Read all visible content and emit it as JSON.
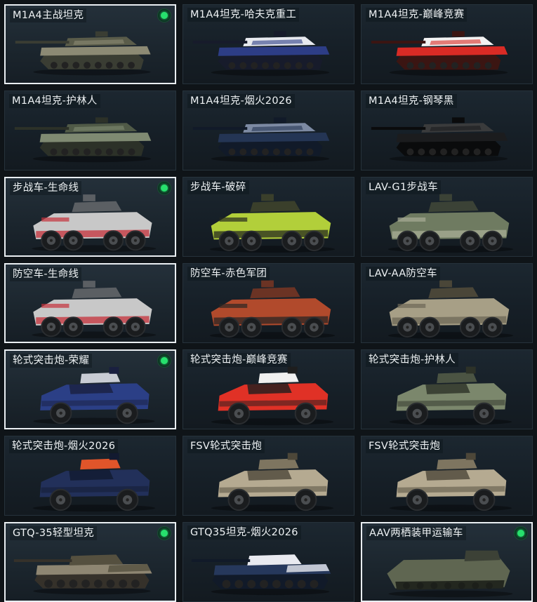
{
  "vehicles": [
    {
      "label": "M1A4主战坦克",
      "type": "tank",
      "colors": [
        "#8c8a74",
        "#5a5c4a",
        "#3a3d33"
      ],
      "selected": true,
      "badge": true
    },
    {
      "label": "M1A4坦克-哈夫克重工",
      "type": "tank",
      "colors": [
        "#2d3d86",
        "#e7e9ee",
        "#171b2b"
      ],
      "selected": false,
      "badge": false
    },
    {
      "label": "M1A4坦克-巅峰竞赛",
      "type": "tank",
      "colors": [
        "#d92b25",
        "#f2f2f2",
        "#3b1512"
      ],
      "selected": false,
      "badge": false
    },
    {
      "label": "M1A4坦克-护林人",
      "type": "tank",
      "colors": [
        "#7f8a72",
        "#505a47",
        "#2c3128"
      ],
      "selected": false,
      "badge": false
    },
    {
      "label": "M1A4坦克-烟火2026",
      "type": "tank",
      "colors": [
        "#243554",
        "#7d8aa3",
        "#111a29"
      ],
      "selected": false,
      "badge": false
    },
    {
      "label": "M1A4坦克-钢琴黑",
      "type": "tank",
      "colors": [
        "#1b1c1e",
        "#3a3b3c",
        "#0a0b0c"
      ],
      "selected": false,
      "badge": false
    },
    {
      "label": "步战车-生命线",
      "type": "apc",
      "colors": [
        "#c8c8c8",
        "#c5313b",
        "#5b5f63"
      ],
      "selected": true,
      "badge": true
    },
    {
      "label": "步战车-破碎",
      "type": "apc",
      "colors": [
        "#b2cf3a",
        "#26291f",
        "#3a3f2b"
      ],
      "selected": false,
      "badge": false
    },
    {
      "label": "LAV-G1步战车",
      "type": "apc",
      "colors": [
        "#6f7b61",
        "#a8ad96",
        "#3b4236"
      ],
      "selected": false,
      "badge": false
    },
    {
      "label": "防空车-生命线",
      "type": "apc",
      "colors": [
        "#c8c8c8",
        "#c5313b",
        "#5b5f63"
      ],
      "selected": true,
      "badge": false
    },
    {
      "label": "防空车-赤色军团",
      "type": "apc",
      "colors": [
        "#b14a2c",
        "#2b2623",
        "#6b3324"
      ],
      "selected": false,
      "badge": false
    },
    {
      "label": "LAV-AA防空车",
      "type": "apc",
      "colors": [
        "#a79f86",
        "#6c6755",
        "#4a4638"
      ],
      "selected": false,
      "badge": false
    },
    {
      "label": "轮式突击炮-荣耀",
      "type": "armored",
      "colors": [
        "#2b3f86",
        "#c9ccd4",
        "#1a2040"
      ],
      "selected": true,
      "badge": true
    },
    {
      "label": "轮式突击炮-巅峰竞赛",
      "type": "armored",
      "colors": [
        "#e03126",
        "#f0f0f0",
        "#1e1e1e"
      ],
      "selected": false,
      "badge": false
    },
    {
      "label": "轮式突击炮-护林人",
      "type": "armored",
      "colors": [
        "#7b876c",
        "#4b5443",
        "#2d3228"
      ],
      "selected": false,
      "badge": false
    },
    {
      "label": "轮式突击炮-烟火2026",
      "type": "armored",
      "colors": [
        "#22305a",
        "#e0552a",
        "#121a30"
      ],
      "selected": false,
      "badge": false
    },
    {
      "label": "FSV轮式突击炮",
      "type": "armored",
      "colors": [
        "#b5aa91",
        "#7e7560",
        "#4d4739"
      ],
      "selected": false,
      "badge": false
    },
    {
      "label": "FSV轮式突击炮",
      "type": "armored",
      "colors": [
        "#b5aa91",
        "#7e7560",
        "#4d4739"
      ],
      "selected": false,
      "badge": false
    },
    {
      "label": "GTQ-35轻型坦克",
      "type": "light",
      "colors": [
        "#8e8672",
        "#55503f",
        "#35312a"
      ],
      "selected": true,
      "badge": true
    },
    {
      "label": "GTQ35坦克-烟火2026",
      "type": "light",
      "colors": [
        "#26385c",
        "#e9eaf0",
        "#111a29"
      ],
      "selected": false,
      "badge": false
    },
    {
      "label": "AAV两栖装甲运输车",
      "type": "aav",
      "colors": [
        "#5f6651",
        "#3c4136",
        "#23271f"
      ],
      "selected": true,
      "badge": true
    }
  ]
}
